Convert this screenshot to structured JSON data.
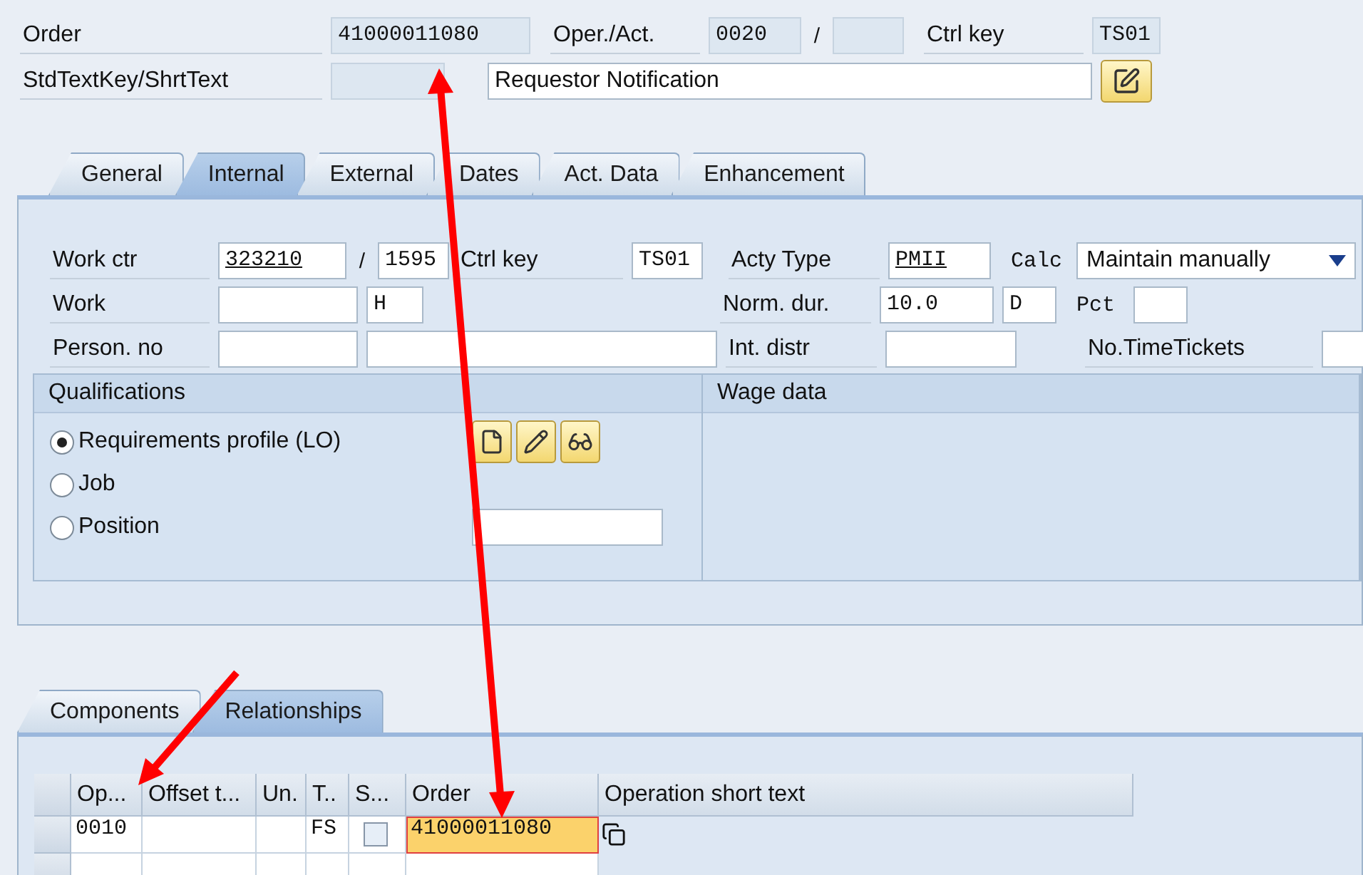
{
  "header": {
    "order": {
      "label": "Order",
      "value": "41000011080"
    },
    "operation": {
      "label": "Oper./Act.",
      "value": "0020",
      "separator": "/"
    },
    "control_key": {
      "label": "Ctrl key",
      "value": "TS01"
    },
    "std_text": {
      "label": "StdTextKey/ShrtText",
      "short_text": "Requestor Notification"
    }
  },
  "tabs": [
    {
      "label": "General",
      "selected": false
    },
    {
      "label": "Internal",
      "selected": true
    },
    {
      "label": "External",
      "selected": false
    },
    {
      "label": "Dates",
      "selected": false
    },
    {
      "label": "Act. Data",
      "selected": false
    },
    {
      "label": "Enhancement",
      "selected": false
    }
  ],
  "internal": {
    "work_ctr": {
      "label": "Work ctr",
      "value": "323210",
      "separator": "/",
      "plant": "1595"
    },
    "ctrl_key": {
      "label": "Ctrl key",
      "value": "TS01"
    },
    "acty_type": {
      "label": "Acty Type",
      "value": "PMII"
    },
    "calc": {
      "label": "Calc",
      "value": "Maintain manually"
    },
    "work": {
      "label": "Work",
      "unit": "H"
    },
    "norm_dur": {
      "label": "Norm. dur.",
      "value": "10.0",
      "unit": "D"
    },
    "pct": {
      "label": "Pct"
    },
    "person_no": {
      "label": "Person. no"
    },
    "int_distr": {
      "label": "Int. distr"
    },
    "time_tickets": {
      "label": "No.TimeTickets"
    }
  },
  "qualifications": {
    "title": "Qualifications",
    "options": [
      {
        "label": "Requirements profile (LO)",
        "selected": true
      },
      {
        "label": "Job",
        "selected": false
      },
      {
        "label": "Position",
        "selected": false
      }
    ]
  },
  "wage_data": {
    "title": "Wage data"
  },
  "bottom_tabs": [
    {
      "label": "Components",
      "selected": false
    },
    {
      "label": "Relationships",
      "selected": true
    }
  ],
  "relationships": {
    "columns": [
      "Op...",
      "Offset t...",
      "Un.",
      "T..",
      "S...",
      "Order",
      "Operation short text"
    ],
    "rows": [
      {
        "operation": "0010",
        "type": "FS",
        "checked": false,
        "order": "41000011080",
        "order_focused": true
      }
    ]
  }
}
